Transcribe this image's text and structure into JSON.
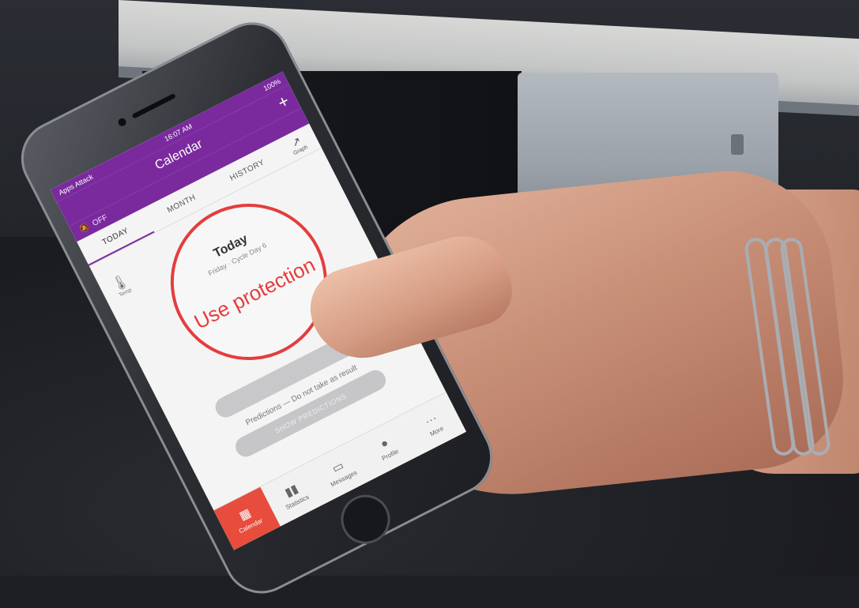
{
  "status_bar": {
    "carrier": "Apps Attack",
    "time": "16:07 AM",
    "battery": "100%"
  },
  "app_bar": {
    "title": "Calendar",
    "add_label": "+"
  },
  "sub_bar": {
    "mode_label": "OFF"
  },
  "tabs": [
    {
      "label": "TODAY"
    },
    {
      "label": "MONTH"
    },
    {
      "label": "HISTORY"
    }
  ],
  "graph_tab": {
    "icon": "graph-icon",
    "label": "Graph"
  },
  "side_icon": {
    "icon": "thermometer-icon",
    "label": "Temp"
  },
  "today_card": {
    "heading": "Today",
    "subtitle": "Friday · Cycle Day 6",
    "status": "Use protection",
    "status_color": "#e43d3d"
  },
  "predictions": {
    "note": "Predictions — Do not take as result",
    "button_label": "SHOW PREDICTIONS"
  },
  "bottom_nav": [
    {
      "icon": "calendar-icon",
      "label": "Calendar",
      "active": true
    },
    {
      "icon": "statistics-icon",
      "label": "Statistics"
    },
    {
      "icon": "messages-icon",
      "label": "Messages"
    },
    {
      "icon": "profile-icon",
      "label": "Profile"
    },
    {
      "icon": "more-icon",
      "label": "More"
    }
  ],
  "colors": {
    "brand": "#7b2a9e",
    "alert": "#e43d3d",
    "nav_active": "#e74c3c"
  }
}
